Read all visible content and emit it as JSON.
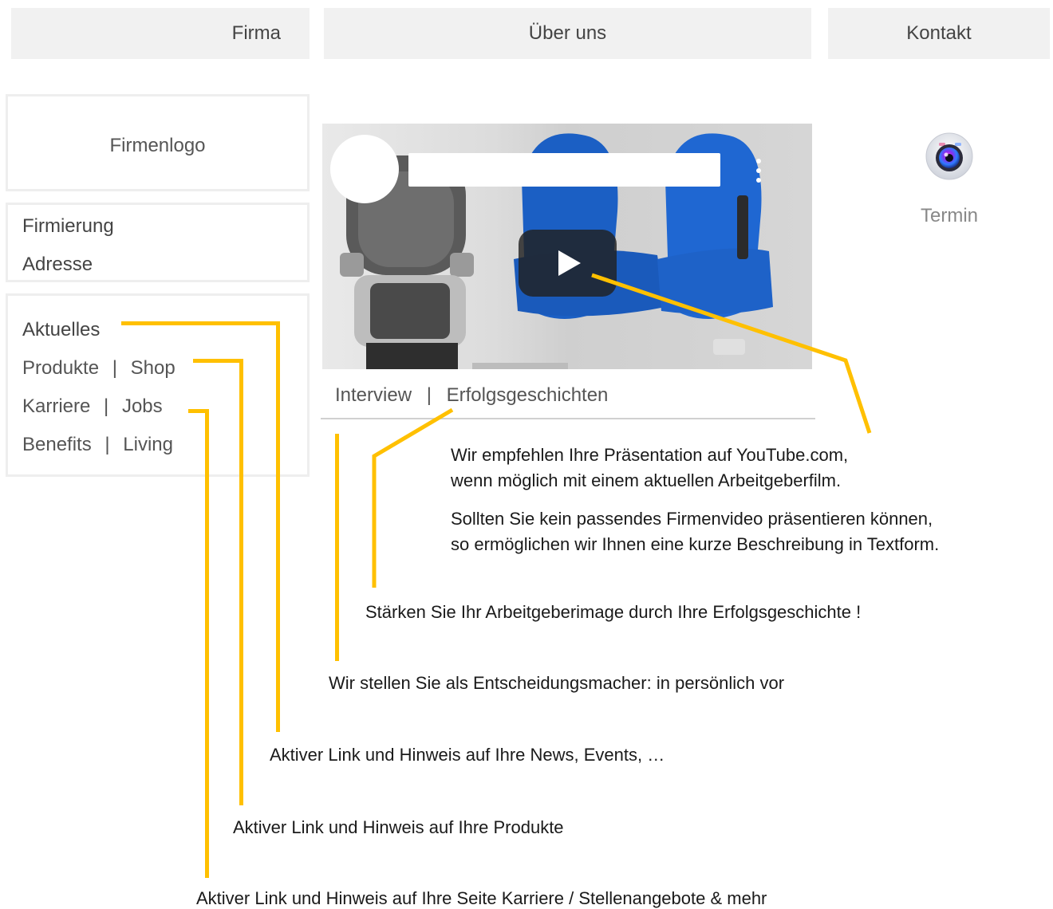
{
  "header": {
    "tabs": [
      {
        "label": "Firma"
      },
      {
        "label": "Über uns"
      },
      {
        "label": "Kontakt"
      }
    ]
  },
  "sidebar": {
    "logo_label": "Firmenlogo",
    "company_lines": [
      "Firmierung",
      "Adresse"
    ],
    "separator": "|",
    "links": {
      "aktuelles": "Aktuelles",
      "produkte": "Produkte",
      "shop": "Shop",
      "karriere": "Karriere",
      "jobs": "Jobs",
      "benefits": "Benefits",
      "living": "Living"
    }
  },
  "video": {
    "tabs": {
      "interview": "Interview",
      "erfolg": "Erfolgsgeschichten"
    }
  },
  "termin": {
    "label": "Termin"
  },
  "annotations": {
    "youtube_1": "Wir empfehlen Ihre Präsentation auf YouTube.com,",
    "youtube_2": "wenn möglich mit einem aktuellen Arbeitgeberfilm.",
    "text_1": "Sollten Sie kein passendes Firmenvideo präsentieren können,",
    "text_2": "so ermöglichen wir Ihnen eine kurze Beschreibung in Textform.",
    "erfolg": "Stärken Sie Ihr Arbeitgeberimage durch Ihre Erfolgsgeschichte !",
    "interview": "Wir stellen Sie als Entscheidungsmacher: in persönlich vor",
    "aktuelles": "Aktiver Link und Hinweis auf Ihre News, Events, …",
    "produkte": "Aktiver Link und Hinweis auf Ihre Produkte",
    "karriere": "Aktiver Link und Hinweis auf Ihre Seite Karriere / Stellenangebote & mehr"
  },
  "colors": {
    "accent": "#FFC000",
    "tab_bg": "#f1f1f1",
    "panel_border": "#eeeeee"
  }
}
